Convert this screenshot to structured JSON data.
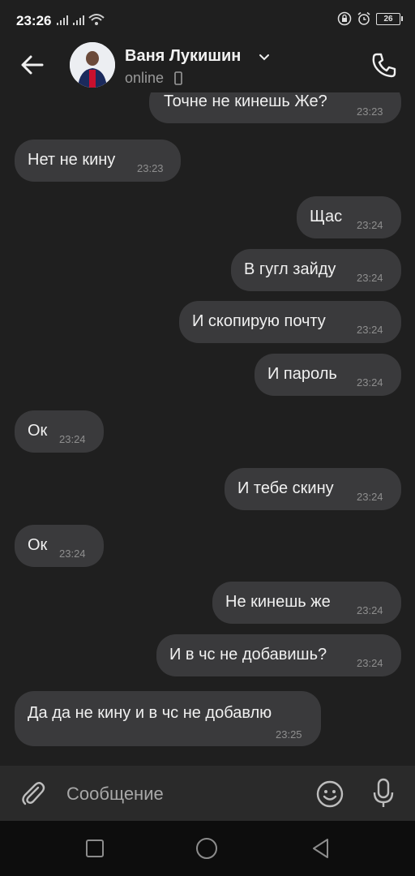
{
  "status_bar": {
    "time": "23:26",
    "battery": "26"
  },
  "header": {
    "contact_name": "Ваня Лукишин",
    "status": "online",
    "icons": [
      "back-arrow-icon",
      "chevron-down-icon",
      "phone-device-icon",
      "phone-call-icon"
    ]
  },
  "messages": [
    {
      "side": "out",
      "text": "Точне не кинешь Же?",
      "time": "23:23"
    },
    {
      "side": "in",
      "text": "Нет не кину",
      "time": "23:23"
    },
    {
      "side": "out",
      "text": "Щас",
      "time": "23:24"
    },
    {
      "side": "out",
      "text": "В гугл зайду",
      "time": "23:24"
    },
    {
      "side": "out",
      "text": "И скопирую почту",
      "time": "23:24"
    },
    {
      "side": "out",
      "text": "И пароль",
      "time": "23:24"
    },
    {
      "side": "in",
      "text": "Ок",
      "time": "23:24"
    },
    {
      "side": "out",
      "text": "И тебе скину",
      "time": "23:24"
    },
    {
      "side": "in",
      "text": "Ок",
      "time": "23:24"
    },
    {
      "side": "out",
      "text": "Не кинешь же",
      "time": "23:24"
    },
    {
      "side": "out",
      "text": "И в чс не добавишь?",
      "time": "23:24"
    },
    {
      "side": "in",
      "text": "Да да не кину и в чс не добавлю",
      "time": "23:25"
    }
  ],
  "composer": {
    "placeholder": "Сообщение",
    "icons": [
      "paperclip-icon",
      "emoji-icon",
      "microphone-icon"
    ]
  },
  "colors": {
    "background": "#1f1f1f",
    "bubble": "#3a3a3c",
    "input_bar": "#2a2a2a",
    "nav_bar": "#0d0d0d"
  }
}
